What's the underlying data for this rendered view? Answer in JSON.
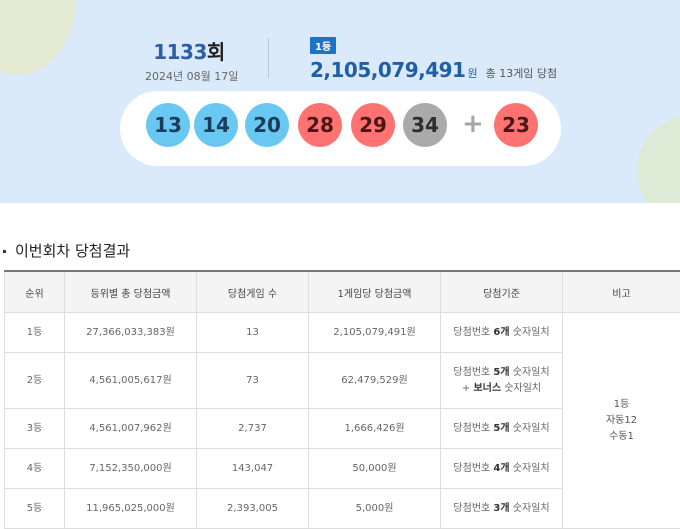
{
  "draw": {
    "round_number": "1133",
    "round_unit": "회",
    "date": "2024년 08월 17일"
  },
  "first_prize": {
    "badge": "1등",
    "amount": "2,105,079,491",
    "unit": "원",
    "note": "총 13게임 당첨"
  },
  "numbers": {
    "main": [
      {
        "value": "13",
        "color": "#69c8f2"
      },
      {
        "value": "14",
        "color": "#69c8f2"
      },
      {
        "value": "20",
        "color": "#69c8f2"
      },
      {
        "value": "28",
        "color": "#ff7272"
      },
      {
        "value": "29",
        "color": "#ff7272"
      },
      {
        "value": "34",
        "color": "#aaaaaa"
      }
    ],
    "plus": "+",
    "bonus": {
      "value": "23",
      "color": "#ff7272"
    }
  },
  "section_title": "이번회차 당첨결과",
  "table": {
    "headers": [
      "순위",
      "등위별 총 당첨금액",
      "당첨게임 수",
      "1게임당 당첨금액",
      "당첨기준",
      "비고"
    ],
    "rows": [
      {
        "rank": "1등",
        "total": "27,366,033,383원",
        "games": "13",
        "per_game": "2,105,079,491원",
        "crit_pre": "당첨번호 ",
        "crit_bold": "6개",
        "crit_post": " 숫자일치"
      },
      {
        "rank": "2등",
        "total": "4,561,005,617원",
        "games": "73",
        "per_game": "62,479,529원",
        "crit_pre": "당첨번호 ",
        "crit_bold": "5개",
        "crit_post": " 숫자일치",
        "crit2_pre": "+ ",
        "crit2_bold": "보너스",
        "crit2_post": " 숫자일치"
      },
      {
        "rank": "3등",
        "total": "4,561,007,962원",
        "games": "2,737",
        "per_game": "1,666,426원",
        "crit_pre": "당첨번호 ",
        "crit_bold": "5개",
        "crit_post": " 숫자일치"
      },
      {
        "rank": "4등",
        "total": "7,152,350,000원",
        "games": "143,047",
        "per_game": "50,000원",
        "crit_pre": "당첨번호 ",
        "crit_bold": "4개",
        "crit_post": " 숫자일치"
      },
      {
        "rank": "5등",
        "total": "11,965,025,000원",
        "games": "2,393,005",
        "per_game": "5,000원",
        "crit_pre": "당첨번호 ",
        "crit_bold": "3개",
        "crit_post": " 숫자일치"
      }
    ],
    "note": {
      "line1": "1등",
      "line2": "자동12",
      "line3": "수동1"
    }
  }
}
